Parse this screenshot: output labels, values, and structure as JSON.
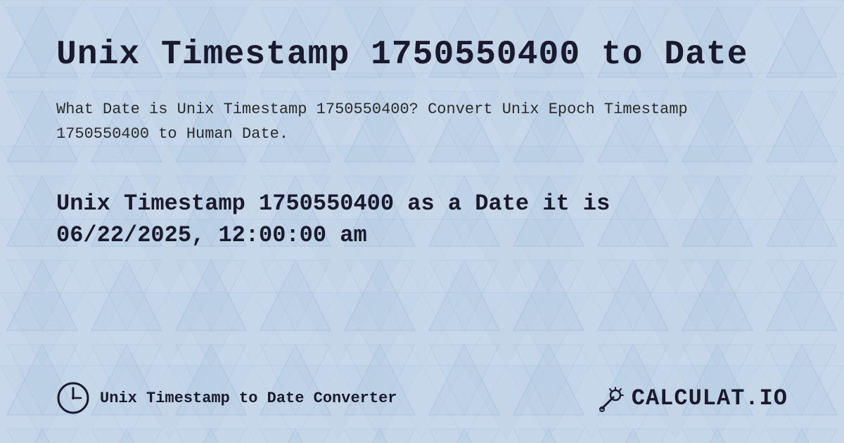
{
  "page": {
    "background_color": "#c8d8e8",
    "title": "Unix Timestamp 1750550400 to Date",
    "description": "What Date is Unix Timestamp 1750550400? Convert Unix Epoch Timestamp 1750550400 to Human Date.",
    "result_line1": "Unix Timestamp 1750550400 as a Date it is",
    "result_line2": "06/22/2025, 12:00:00 am",
    "footer": {
      "link_text": "Unix Timestamp to Date Converter",
      "logo_text": "CALCULAT.IO"
    }
  }
}
